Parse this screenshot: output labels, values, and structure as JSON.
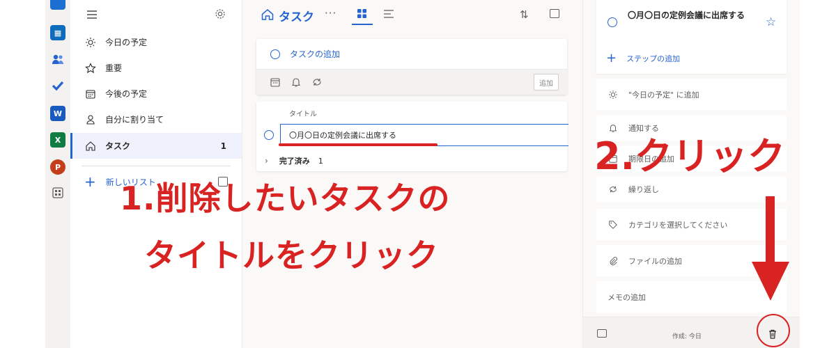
{
  "nav": {
    "items": [
      {
        "label": "今日の予定",
        "icon": "sun-icon"
      },
      {
        "label": "重要",
        "icon": "star-icon"
      },
      {
        "label": "今後の予定",
        "icon": "calendar-icon"
      },
      {
        "label": "自分に割り当て",
        "icon": "person-icon"
      },
      {
        "label": "タスク",
        "icon": "home-icon",
        "count": "1",
        "active": true
      }
    ],
    "new_list": "新しいリスト"
  },
  "main": {
    "title": "タスク",
    "more": "···",
    "add_task_placeholder": "タスクの追加",
    "add_button": "追加",
    "column_header": "タイトル",
    "task_title": "〇月〇日の定例会議に出席する",
    "completed_label": "完了済み",
    "completed_count": "1"
  },
  "detail": {
    "task_title": "〇月〇日の定例会議に出席する",
    "add_step": "ステップの追加",
    "add_to_today": "\"今日の予定\" に追加",
    "remind": "通知する",
    "due_date": "期限日の追加",
    "repeat": "繰り返し",
    "category": "カテゴリを選択してください",
    "add_file": "ファイルの追加",
    "note": "メモの追加",
    "created": "作成: 今日"
  },
  "annotations": {
    "step1_line1": "1.削除したいタスクの",
    "step1_line2": "タイトルをクリック",
    "step2": "2.クリック"
  },
  "colors": {
    "accent": "#2564cf",
    "annotation": "#d92323"
  }
}
